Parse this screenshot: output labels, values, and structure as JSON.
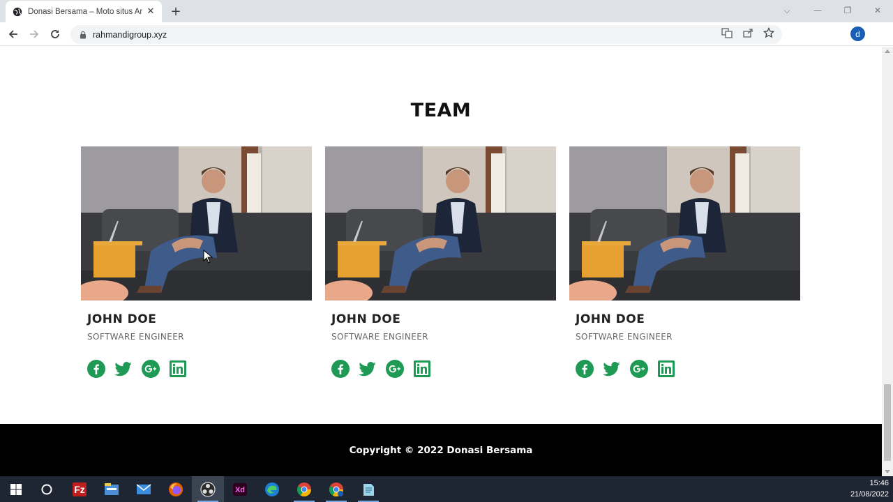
{
  "browser": {
    "tab_title": "Donasi Bersama – Moto situs An",
    "url": "rahmandigroup.xyz",
    "profile_initial": "d"
  },
  "page": {
    "section_title": "TEAM",
    "members": [
      {
        "name": "JOHN DOE",
        "role": "SOFTWARE ENGINEER"
      },
      {
        "name": "JOHN DOE",
        "role": "SOFTWARE ENGINEER"
      },
      {
        "name": "JOHN DOE",
        "role": "SOFTWARE ENGINEER"
      }
    ],
    "social_icons": [
      "facebook-icon",
      "twitter-icon",
      "google-plus-icon",
      "linkedin-icon"
    ],
    "accent_color": "#1f9a55",
    "footer_text": "Copyright © 2022 Donasi Bersama"
  },
  "taskbar": {
    "time": "15:46",
    "date": "21/08/2022",
    "apps": [
      "windows-start",
      "cortana",
      "filezilla",
      "file-explorer",
      "mail",
      "firefox",
      "obs",
      "adobe-xd",
      "edge",
      "chrome",
      "chrome-profile",
      "notepad"
    ]
  }
}
